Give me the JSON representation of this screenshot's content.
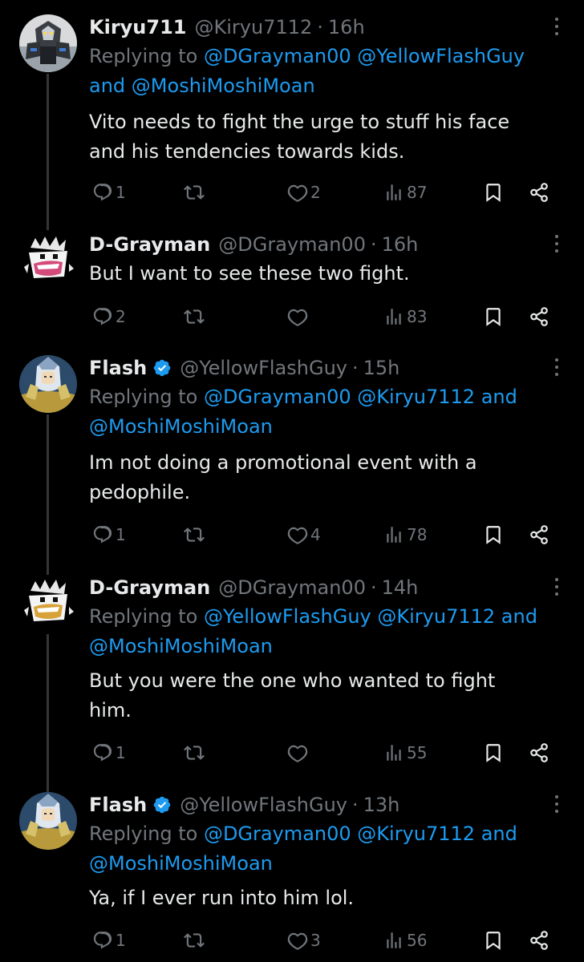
{
  "colors": {
    "background": "#000000",
    "text": "#e7e9ea",
    "muted": "#71767b",
    "mention": "#1d9bf0",
    "thread_line": "#333639"
  },
  "tweets": [
    {
      "name": "Kiryu711",
      "handle": "@Kiryu7112",
      "time": "16h",
      "verified": false,
      "avatar_icon": "mecha-robot-avatar",
      "replying_prefix": "Replying to",
      "replying_line1_mentions": [
        "@DGrayman00",
        "@YellowFlashGuy"
      ],
      "replying_line2_prefix": "and",
      "replying_line2_mentions": [
        "@MoshiMoshiMoan"
      ],
      "text_lines": [
        "Vito needs to fight the urge to stuff his face",
        "and his tendencies towards kids."
      ],
      "replies": "1",
      "retweets": "",
      "likes": "2",
      "views": "87"
    },
    {
      "name": "D-Grayman",
      "handle": "@DGrayman00",
      "time": "16h",
      "verified": false,
      "avatar_icon": "cartoon-grin-avatar",
      "text_lines": [
        "But I want to see these two fight."
      ],
      "replies": "2",
      "retweets": "",
      "likes": "",
      "views": "83"
    },
    {
      "name": "Flash",
      "handle": "@YellowFlashGuy",
      "time": "15h",
      "verified": true,
      "avatar_icon": "armored-knight-avatar",
      "replying_prefix": "Replying to",
      "replying_line1_mentions": [
        "@DGrayman00",
        "@Kiryu7112"
      ],
      "replying_line1_suffix": "and",
      "replying_line2_mentions": [
        "@MoshiMoshiMoan"
      ],
      "text_lines": [
        "Im not doing a promotional event with a",
        "pedophile."
      ],
      "replies": "1",
      "retweets": "",
      "likes": "4",
      "views": "78"
    },
    {
      "name": "D-Grayman",
      "handle": "@DGrayman00",
      "time": "14h",
      "verified": false,
      "avatar_icon": "cartoon-grin-avatar",
      "replying_prefix": "Replying to",
      "replying_line1_mentions": [
        "@YellowFlashGuy",
        "@Kiryu7112"
      ],
      "replying_line1_suffix": "and",
      "replying_line2_mentions": [
        "@MoshiMoshiMoan"
      ],
      "text_lines": [
        "But you were the one who wanted to fight",
        "him."
      ],
      "replies": "1",
      "retweets": "",
      "likes": "",
      "views": "55"
    },
    {
      "name": "Flash",
      "handle": "@YellowFlashGuy",
      "time": "13h",
      "verified": true,
      "avatar_icon": "armored-knight-avatar",
      "replying_prefix": "Replying to",
      "replying_line1_mentions": [
        "@DGrayman00",
        "@Kiryu7112"
      ],
      "replying_line1_suffix": "and",
      "replying_line2_mentions": [
        "@MoshiMoshiMoan"
      ],
      "text_lines": [
        "Ya, if I ever run into him lol."
      ],
      "replies": "1",
      "retweets": "",
      "likes": "3",
      "views": "56"
    }
  ]
}
